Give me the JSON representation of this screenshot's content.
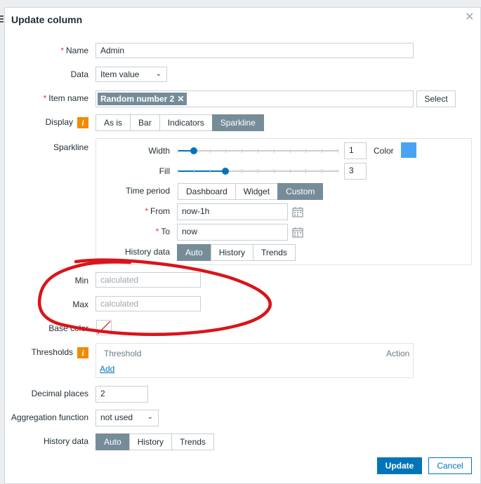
{
  "dialog": {
    "title": "Update column",
    "close_glyph": "✕"
  },
  "fields": {
    "name_label": "Name",
    "name_value": "Admin",
    "data_label": "Data",
    "data_value": "Item value",
    "item_name_label": "Item name",
    "item_tag": "Random number 2",
    "item_tag_remove": "✕",
    "select_label": "Select",
    "display_label": "Display",
    "display_options": [
      "As is",
      "Bar",
      "Indicators",
      "Sparkline"
    ],
    "display_selected": "Sparkline",
    "sparkline_label": "Sparkline",
    "min_label": "Min",
    "min_placeholder": "calculated",
    "max_label": "Max",
    "max_placeholder": "calculated",
    "base_color_label": "Base color",
    "thresholds_label": "Thresholds",
    "threshold_col": "Threshold",
    "action_col": "Action",
    "add_link": "Add",
    "decimal_label": "Decimal places",
    "decimal_value": "2",
    "aggregation_label": "Aggregation function",
    "aggregation_value": "not used",
    "history_label": "History data",
    "history_options": [
      "Auto",
      "History",
      "Trends"
    ],
    "history_selected": "Auto"
  },
  "sparkline": {
    "width_label": "Width",
    "width_value": "1",
    "width_level": 0.1,
    "color_label": "Color",
    "color": "#4aa3f2",
    "fill_label": "Fill",
    "fill_value": "3",
    "fill_level": 0.3,
    "time_period_label": "Time period",
    "time_period_options": [
      "Dashboard",
      "Widget",
      "Custom"
    ],
    "time_period_selected": "Custom",
    "from_label": "From",
    "from_value": "now-1h",
    "to_label": "To",
    "to_value": "now",
    "history_label": "History data",
    "history_options": [
      "Auto",
      "History",
      "Trends"
    ],
    "history_selected": "Auto"
  },
  "footer": {
    "update": "Update",
    "cancel": "Cancel"
  },
  "icons": {
    "info": "i",
    "required": "*",
    "chevron": "⌄"
  },
  "colors": {
    "accent": "#0275b8",
    "segment_active": "#768d99",
    "warning": "#f28b00",
    "annotation": "#d9141a"
  }
}
